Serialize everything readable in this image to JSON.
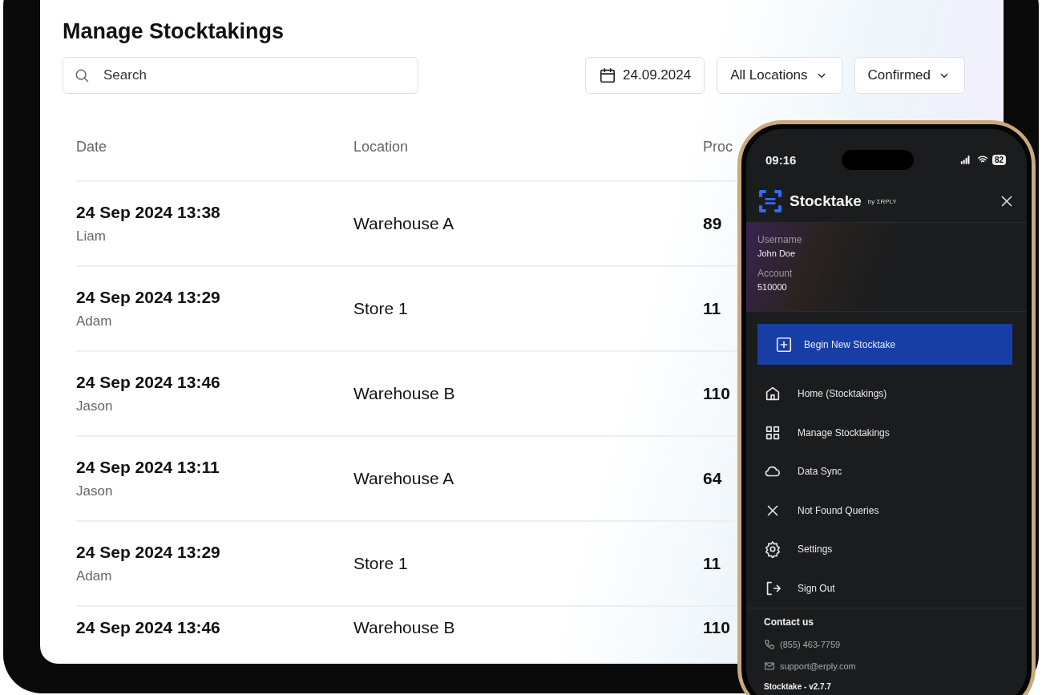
{
  "tablet": {
    "title": "Manage Stocktakings",
    "search": {
      "placeholder": "Search"
    },
    "filters": [
      {
        "kind": "date",
        "label": "24.09.2024"
      },
      {
        "kind": "dropdown",
        "label": "All Locations"
      },
      {
        "kind": "dropdown",
        "label": "Confirmed"
      }
    ],
    "table": {
      "columns": [
        "Date",
        "Location",
        "Proc"
      ],
      "rows": [
        {
          "date": "24 Sep 2024 13:38",
          "user": "Liam",
          "location": "Warehouse A",
          "column_3": "89"
        },
        {
          "date": "24 Sep 2024 13:29",
          "user": "Adam",
          "location": "Store 1",
          "column_3": "11"
        },
        {
          "date": "24 Sep 2024 13:46",
          "user": "Jason",
          "location": "Warehouse B",
          "column_3": "110"
        },
        {
          "date": "24 Sep 2024 13:11",
          "user": "Jason",
          "location": "Warehouse A",
          "column_3": "64"
        },
        {
          "date": "24 Sep 2024 13:29",
          "user": "Adam",
          "location": "Store 1",
          "column_3": "11"
        },
        {
          "date": "24 Sep 2024 13:46",
          "user": "",
          "location": "Warehouse B",
          "column_3": "110"
        }
      ]
    }
  },
  "phone": {
    "status_bar": {
      "time": "09:16",
      "battery": "82"
    },
    "app": {
      "name": "Stocktake",
      "by": "by ΣRPLY"
    },
    "account": [
      {
        "label": "Username",
        "value": "John Doe"
      },
      {
        "label": "Account",
        "value": "510000"
      }
    ],
    "primary_button": "Begin New Stocktake",
    "menu": [
      {
        "kind": "home",
        "label": "Home (Stocktakings)"
      },
      {
        "kind": "grid",
        "label": "Manage Stocktakings"
      },
      {
        "kind": "cloud",
        "label": "Data Sync"
      },
      {
        "kind": "x",
        "label": "Not Found Queries"
      },
      {
        "kind": "gear",
        "label": "Settings"
      },
      {
        "kind": "signout",
        "label": "Sign Out"
      }
    ],
    "contact": {
      "title": "Contact us",
      "items": [
        {
          "kind": "phone",
          "text": "(855) 463-7759"
        },
        {
          "kind": "mail",
          "text": "support@erply.com"
        }
      ]
    },
    "version": "Stocktake - v2.7.7"
  }
}
